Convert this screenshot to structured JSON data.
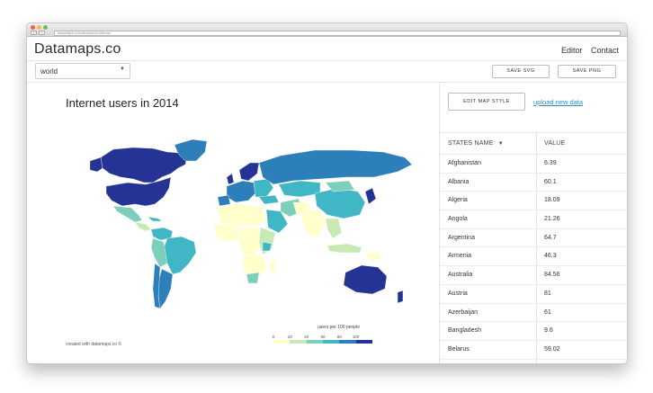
{
  "browser": {
    "url": "datamaps.co/editor/world-internet"
  },
  "app": {
    "brand": "Datamaps.co",
    "nav": {
      "editor": "Editor",
      "contact": "Contact"
    }
  },
  "toolbar": {
    "map_select": "world",
    "save_svg": "SAVE SVG",
    "save_png": "SAVE PNG"
  },
  "map": {
    "title": "Internet users in 2014",
    "legend_title": "users per 100 people",
    "legend_ticks": [
      "0",
      "20",
      "40",
      "60",
      "80",
      "100"
    ],
    "legend_colors": [
      "#ffffcc",
      "#c7e9b4",
      "#7fcdbb",
      "#41b6c4",
      "#2c7fb8",
      "#253494"
    ],
    "credit": "created with datamaps.co ©"
  },
  "sidebar": {
    "edit_style": "EDIT MAP STYLE",
    "upload": "upload new data",
    "col_name": "STATES NAME",
    "col_value": "VALUE",
    "rows": [
      {
        "name": "Afghanistan",
        "value": "6.39"
      },
      {
        "name": "Albania",
        "value": "60.1"
      },
      {
        "name": "Algeria",
        "value": "18.09"
      },
      {
        "name": "Angola",
        "value": "21.26"
      },
      {
        "name": "Argentina",
        "value": "64.7"
      },
      {
        "name": "Armenia",
        "value": "46.3"
      },
      {
        "name": "Australia",
        "value": "84.56"
      },
      {
        "name": "Austria",
        "value": "81"
      },
      {
        "name": "Azerbaijan",
        "value": "61"
      },
      {
        "name": "Bangladesh",
        "value": "9.6"
      },
      {
        "name": "Belarus",
        "value": "59.02"
      }
    ]
  }
}
